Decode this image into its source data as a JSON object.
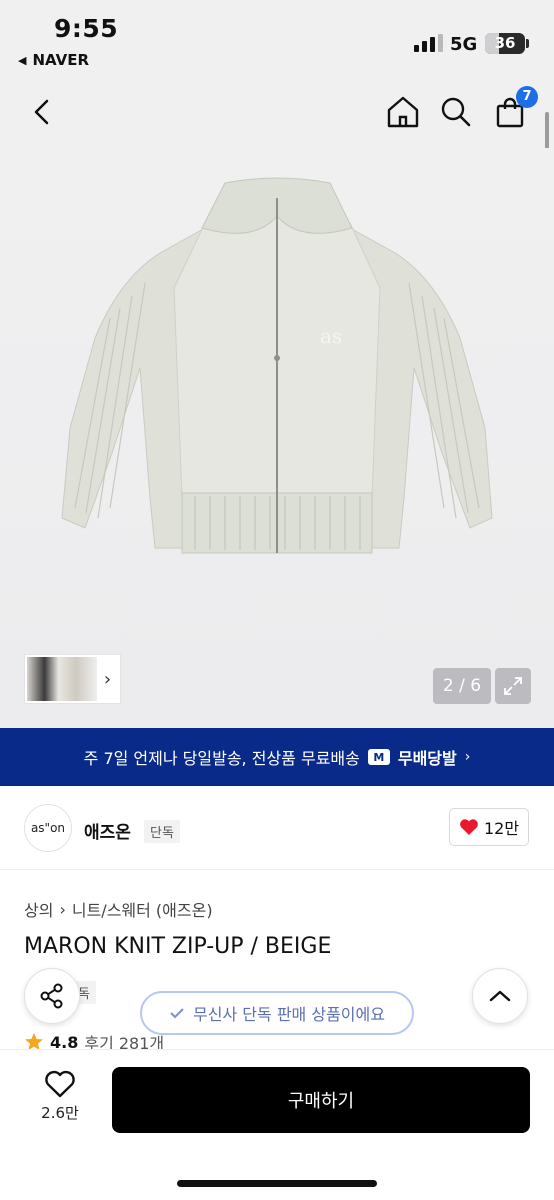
{
  "status_bar": {
    "time": "9:55",
    "back_app": "NAVER",
    "network": "5G",
    "battery": "36",
    "battery_level": 0.36
  },
  "header": {
    "cart_count": "7"
  },
  "gallery": {
    "counter": "2 / 6",
    "logo_text": "as"
  },
  "banner": {
    "text": "주 7일 언제나 당일발송, 전상품 무료배송",
    "logo": "M",
    "promo": "무배당발"
  },
  "brand": {
    "logo_text": "as\"on",
    "name": "애즈온",
    "tag": "단독",
    "likes": "12만"
  },
  "product": {
    "breadcrumb": [
      "상의",
      "니트/스웨터 (애즈온)"
    ],
    "title": "MARON KNIT ZIP-UP / BEIGE",
    "tag": "단독",
    "rating": "4.8",
    "reviews": "후기 281개"
  },
  "floating": {
    "exclusive_text": "무신사 단독 판매 상품이에요"
  },
  "bottom": {
    "wish_count": "2.6만",
    "buy_label": "구매하기"
  },
  "colors": {
    "banner_bg": "#0a2a8a",
    "badge_blue": "#1c6fe8",
    "heart_red": "#e8192c",
    "star": "#f5a623"
  }
}
